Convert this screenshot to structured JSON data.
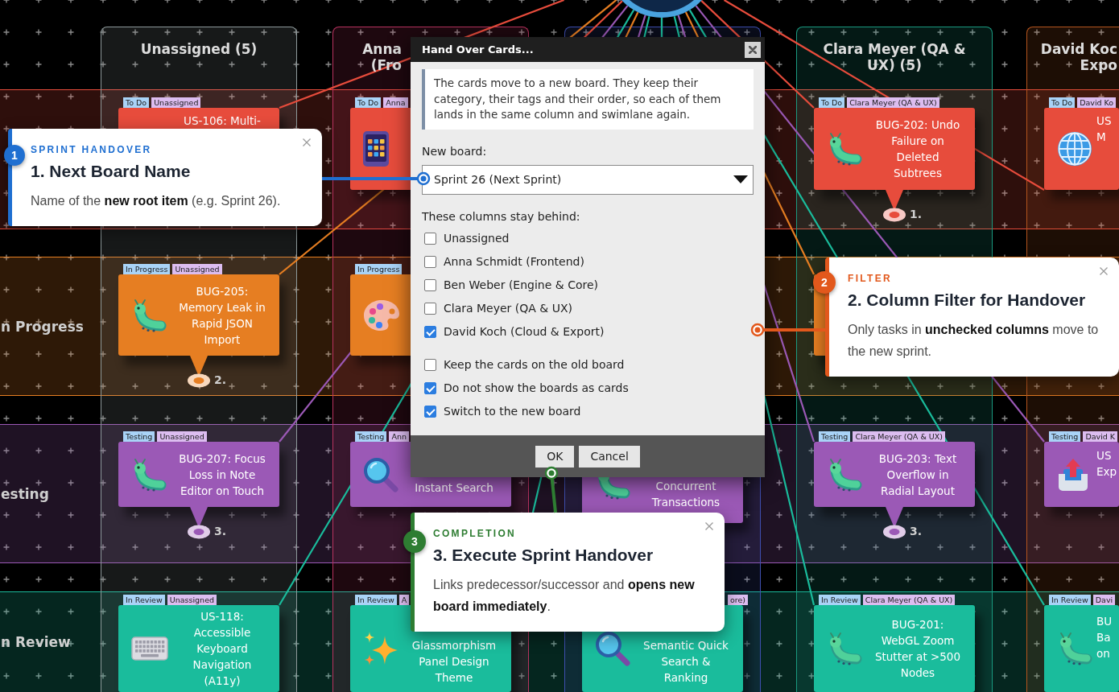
{
  "board": {
    "swimlanes": [
      {
        "kind": "todo",
        "color": "#e74c3c"
      },
      {
        "kind": "in_progress",
        "label": "n Progress",
        "color": "#e67e22"
      },
      {
        "kind": "testing",
        "label": "esting",
        "color": "#9b59b6"
      },
      {
        "kind": "in_review",
        "label": "n Review",
        "color": "#1abc9c"
      }
    ],
    "columns": [
      {
        "header": [
          "Unassigned (5)"
        ],
        "color": "#8e9a9b",
        "cards": [
          {
            "kind": "todo",
            "tags": [
              {
                "kind": "status",
                "text": "To Do"
              },
              {
                "kind": "assignee",
                "text": "Unassigned"
              }
            ],
            "title": "US-106: Multi-"
          },
          {
            "kind": "in_progress",
            "tags": [
              {
                "kind": "status",
                "text": "In Progress"
              },
              {
                "kind": "assignee",
                "text": "Unassigned"
              }
            ],
            "title": "BUG-205: Memory Leak in Rapid JSON Import",
            "marker": "2."
          },
          {
            "kind": "testing",
            "tags": [
              {
                "kind": "status",
                "text": "Testing"
              },
              {
                "kind": "assignee",
                "text": "Unassigned"
              }
            ],
            "title": "BUG-207: Focus Loss in Note Editor on Touch",
            "marker": "3."
          },
          {
            "kind": "in_review",
            "tags": [
              {
                "kind": "status",
                "text": "In Review"
              },
              {
                "kind": "assignee",
                "text": "Unassigned"
              }
            ],
            "title": "US-118: Accessible Keyboard Navigation (A11y)"
          }
        ]
      },
      {
        "header": [
          "Anna",
          "(Fro"
        ],
        "color": "#b8325f",
        "cards": [
          {
            "kind": "todo",
            "tags": [
              {
                "kind": "status",
                "text": "To Do"
              },
              {
                "kind": "assignee",
                "text": "Anna"
              }
            ]
          },
          {
            "kind": "in_progress",
            "tags": [
              {
                "kind": "status",
                "text": "In Progress"
              }
            ]
          },
          {
            "kind": "testing",
            "tags": [
              {
                "kind": "status",
                "text": "Testing"
              },
              {
                "kind": "assignee",
                "text": "Ann"
              }
            ],
            "title": "Instant Search"
          },
          {
            "kind": "in_review",
            "tags": [
              {
                "kind": "status",
                "text": "In Review"
              },
              {
                "kind": "assignee",
                "text": "A"
              }
            ],
            "title": "Glassmorphism Panel Design Theme"
          }
        ]
      },
      {
        "color": "#3f4fb0",
        "cards": [
          {
            "kind": "testing",
            "title": "Concurrent Transactions"
          },
          {
            "kind": "in_review",
            "tags": [
              {
                "kind": "assignee",
                "text": "ore)"
              }
            ],
            "title": "Semantic Quick Search & Ranking"
          }
        ]
      },
      {
        "header": [
          "Clara Meyer (QA &",
          "UX) (5)"
        ],
        "color": "#1a9a80",
        "cards": [
          {
            "kind": "todo",
            "tags": [
              {
                "kind": "status",
                "text": "To Do"
              },
              {
                "kind": "assignee",
                "text": "Clara Meyer (QA & UX)"
              }
            ],
            "title": "BUG-202: Undo Failure on Deleted Subtrees",
            "marker": "1."
          },
          {
            "kind": "in_progress"
          },
          {
            "kind": "testing",
            "tags": [
              {
                "kind": "status",
                "text": "Testing"
              },
              {
                "kind": "assignee",
                "text": "Clara Meyer (QA & UX)"
              }
            ],
            "title": "BUG-203: Text Overflow in Radial Layout",
            "marker": "3."
          },
          {
            "kind": "in_review",
            "tags": [
              {
                "kind": "status",
                "text": "In Review"
              },
              {
                "kind": "assignee",
                "text": "Clara Meyer (QA & UX)"
              }
            ],
            "title": "BUG-201: WebGL Zoom Stutter at >500 Nodes"
          }
        ]
      },
      {
        "header": [
          "David Koc",
          "Expo"
        ],
        "color": "#b5551e",
        "cards": [
          {
            "kind": "todo",
            "tags": [
              {
                "kind": "status",
                "text": "To Do"
              },
              {
                "kind": "assignee",
                "text": "David Ko"
              }
            ],
            "title": "US M"
          },
          {
            "kind": "testing",
            "tags": [
              {
                "kind": "status",
                "text": "Testing"
              },
              {
                "kind": "assignee",
                "text": "David K"
              }
            ],
            "title": "US Exp"
          },
          {
            "kind": "in_review",
            "tags": [
              {
                "kind": "status",
                "text": "In Review"
              },
              {
                "kind": "assignee",
                "text": "Davi"
              }
            ],
            "title": "BU Ba on"
          }
        ]
      }
    ]
  },
  "dialog": {
    "title": "Hand Over Cards...",
    "info": "The cards move to a new board. They keep their category, their tags and their order, so each of them lands in the same column and swimlane again.",
    "board_field": {
      "label": "New board:",
      "value": "Sprint 26 (Next Sprint)"
    },
    "columns_label": "These columns stay behind:",
    "column_options": [
      {
        "label": "Unassigned",
        "checked": false
      },
      {
        "label": "Anna Schmidt (Frontend)",
        "checked": false
      },
      {
        "label": "Ben Weber (Engine & Core)",
        "checked": false
      },
      {
        "label": "Clara Meyer (QA & UX)",
        "checked": false
      },
      {
        "label": "David Koch (Cloud & Export)",
        "checked": true
      }
    ],
    "options": [
      {
        "label": "Keep the cards on the old board",
        "checked": false
      },
      {
        "label": "Do not show the boards as cards",
        "checked": true
      },
      {
        "label": "Switch to the new board",
        "checked": true
      }
    ],
    "buttons": [
      "OK",
      "Cancel"
    ]
  },
  "callouts": [
    {
      "color": "#1f6fd1",
      "badge": "1",
      "category": "SPRINT HANDOVER",
      "title": "1. Next Board Name",
      "body": "Name of the **new root item** (e.g. Sprint 26)."
    },
    {
      "color": "#e2581c",
      "badge": "2",
      "category": "FILTER",
      "title": "2. Column Filter for Handover",
      "body": "Only tasks in **unchecked columns** move to the new sprint."
    },
    {
      "color": "#2e7d32",
      "badge": "3",
      "category": "COMPLETION",
      "title": "3. Execute Sprint Handover",
      "body": "Links predecessor/successor and **opens new board immediately**."
    }
  ]
}
